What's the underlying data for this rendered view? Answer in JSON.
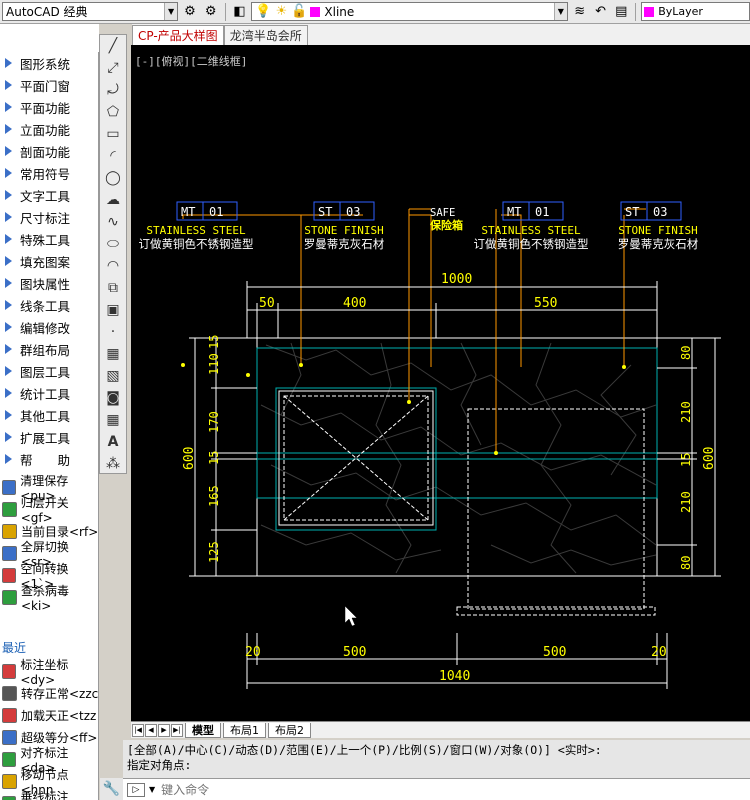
{
  "toolbar": {
    "workspace": "AutoCAD 经典",
    "layer": "Xline",
    "color": "ByLayer"
  },
  "file_tabs": [
    "CP-产品大样图",
    "龙湾半岛会所"
  ],
  "viewport_label": "[-][俯视][二维线框]",
  "left_menu": [
    "图形系统",
    "平面门窗",
    "平面功能",
    "立面功能",
    "剖面功能",
    "常用符号",
    "文字工具",
    "尺寸标注",
    "特殊工具",
    "填充图案",
    "图块属性",
    "线条工具",
    "编辑修改",
    "群组布局",
    "图层工具",
    "统计工具",
    "其他工具",
    "扩展工具",
    "帮　　助"
  ],
  "commands": [
    "清理保存<pu>",
    "归层开关<gf>",
    "当前目录<rf>",
    "全屏切换<sr>",
    "空间转换<1`>",
    "查杀病毒<ki>"
  ],
  "recent_label": "最近",
  "recent_commands": [
    "标注坐标<dy>",
    "转存正常<zzc",
    "加载天正<tzz",
    "超级等分<ff>",
    "对齐标注<da>",
    "移动节点<hnn",
    "垂线标注<bz>"
  ],
  "drawing": {
    "tags": [
      {
        "code": "MT",
        "num": "01",
        "en": "STAINLESS STEEL",
        "cn": "订做黄铜色不锈钢造型"
      },
      {
        "code": "ST",
        "num": "03",
        "en": "STONE FINISH",
        "cn": "罗曼蒂克灰石材"
      },
      {
        "code": "MT",
        "num": "01",
        "en": "STAINLESS STEEL",
        "cn": "订做黄铜色不锈钢造型"
      },
      {
        "code": "ST",
        "num": "03",
        "en": "STONE FINISH",
        "cn": "罗曼蒂克灰石材"
      }
    ],
    "safe_label": "SAFE",
    "safe_cn": "保险箱",
    "dims_top": {
      "total": "1000",
      "left": "50",
      "mid": "400",
      "right": "550"
    },
    "dims_left": {
      "total": "600",
      "a": "110",
      "b": "170",
      "c": "15",
      "d": "165",
      "e": "125",
      "f": "15"
    },
    "dims_right": {
      "total": "600",
      "a": "80",
      "b": "210",
      "c": "15",
      "d": "210",
      "e": "80"
    },
    "dims_bottom": {
      "total": "1040",
      "a": "20",
      "b": "500",
      "c": "500",
      "d": "20"
    }
  },
  "layout_tabs": [
    "模型",
    "布局1",
    "布局2"
  ],
  "command_history": [
    "[全部(A)/中心(C)/动态(D)/范围(E)/上一个(P)/比例(S)/窗口(W)/对象(O)] <实时>:",
    "指定对角点:"
  ],
  "command_placeholder": "键入命令",
  "colors": {
    "canvas": "#000000",
    "dim": "#ffff00",
    "leader": "#ff9900",
    "outline": "#00c0c0",
    "tag": "#3060ff"
  }
}
